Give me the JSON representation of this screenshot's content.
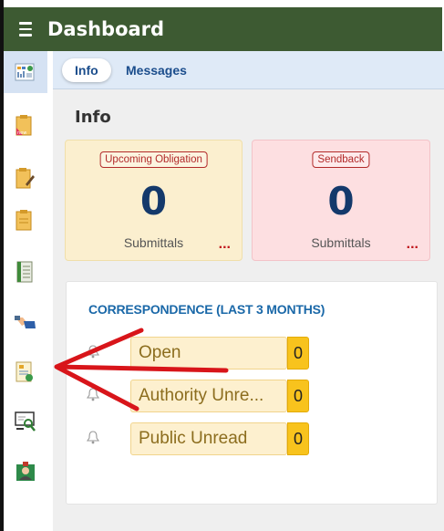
{
  "header": {
    "title": "Dashboard",
    "menu_icon": "hamburger-menu-icon",
    "color": "#3d5a32"
  },
  "sidebar": {
    "items": [
      {
        "name": "dashboard-icon",
        "active": true
      },
      {
        "name": "new-document-icon"
      },
      {
        "name": "edit-document-icon"
      },
      {
        "name": "document-icon"
      },
      {
        "name": "register-icon"
      },
      {
        "name": "handshake-icon"
      },
      {
        "name": "report-icon"
      },
      {
        "name": "search-review-icon"
      },
      {
        "name": "user-badge-icon"
      }
    ]
  },
  "tabs": [
    {
      "label": "Info",
      "active": true
    },
    {
      "label": "Messages",
      "active": false
    }
  ],
  "section_title": "Info",
  "cards": [
    {
      "badge": "Upcoming Obligation",
      "count": "0",
      "label": "Submittals",
      "more": "...",
      "color": "#fbefcf"
    },
    {
      "badge": "Sendback",
      "count": "0",
      "label": "Submittals",
      "more": "...",
      "color": "#fddfe1"
    }
  ],
  "correspondence": {
    "title": "CORRESPONDENCE (LAST 3 MONTHS)",
    "rows": [
      {
        "label": "Open",
        "count": "0"
      },
      {
        "label": "Authority Unre...",
        "count": "0"
      },
      {
        "label": "Public Unread",
        "count": "0"
      }
    ]
  },
  "annotation": {
    "type": "red-arrow",
    "color": "#d8151a",
    "points_to": "report-icon"
  }
}
